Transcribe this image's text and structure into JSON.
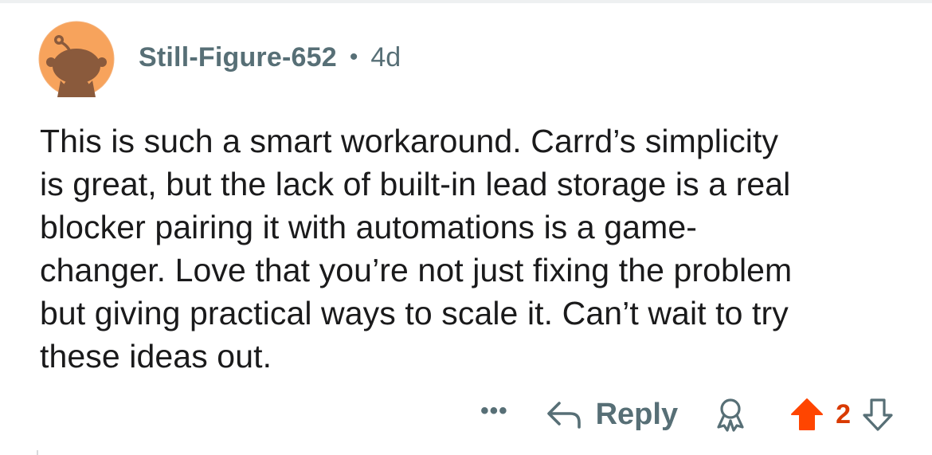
{
  "comment": {
    "author": "Still-Figure-652",
    "separator": "•",
    "age": "4d",
    "avatar_icon": "snoo-avatar-icon",
    "body": "This is such a smart workaround. Carrd’s simplicity is great, but the lack of built-in lead storage is a real blocker pairing it with automations is a game-changer. Love that you’re not just fixing the problem but giving practical ways to scale it. Can’t wait to try these ideas out.",
    "body_lines": [
      "This is such a smart workaround. Carrd’s simplicity",
      "is great, but the lack of built-in lead storage is a real",
      "blocker pairing it with automations is a game-",
      "changer. Love that you’re not just fixing the problem",
      "but giving practical ways to scale it. Can’t wait to try",
      "these ideas out."
    ]
  },
  "actions": {
    "more_label": "•••",
    "reply_label": "Reply",
    "reply_icon": "reply-arrow-icon",
    "award_icon": "award-icon",
    "upvote_icon": "upvote-arrow-icon",
    "downvote_icon": "downvote-arrow-icon",
    "score": "2",
    "upvoted": true
  },
  "colors": {
    "meta_text": "#576f76",
    "body_text": "#1a1a1b",
    "upvote_active": "#ff4500",
    "score_active": "#d93a00",
    "avatar_bg": "#f7a35c",
    "avatar_figure": "#8a5a3c"
  }
}
